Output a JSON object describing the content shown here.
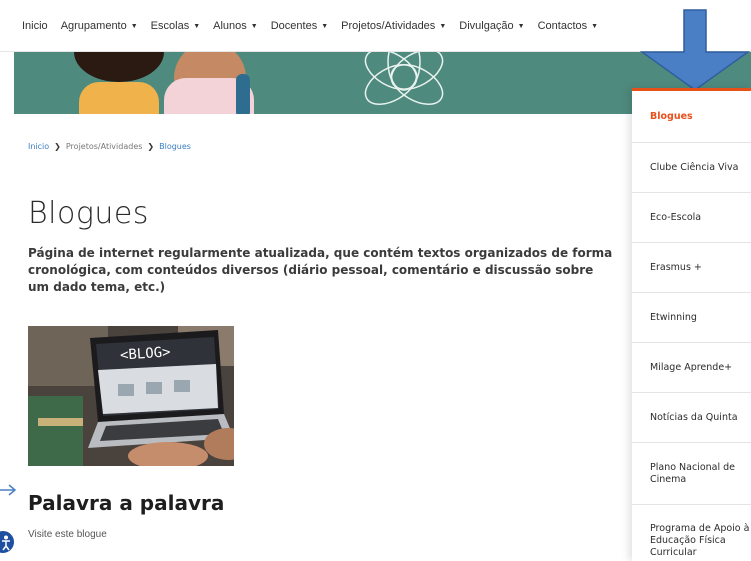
{
  "nav": {
    "items": [
      {
        "label": "Inicio",
        "dropdown": false
      },
      {
        "label": "Agrupamento",
        "dropdown": true
      },
      {
        "label": "Escolas",
        "dropdown": true
      },
      {
        "label": "Alunos",
        "dropdown": true
      },
      {
        "label": "Docentes",
        "dropdown": true
      },
      {
        "label": "Projetos/Atividades",
        "dropdown": true
      },
      {
        "label": "Divulgação",
        "dropdown": true
      },
      {
        "label": "Contactos",
        "dropdown": true
      }
    ]
  },
  "breadcrumb": {
    "items": [
      "Inicio",
      "Projetos/Atividades",
      "Blogues"
    ]
  },
  "page": {
    "title": "Blogues",
    "description": "Página de internet regularmente atualizada, que contém textos organizados de forma cronológica, com conteúdos diversos (diário pessoal, comentário e discussão sobre um dado tema, etc.)",
    "image_text": "<BLOG>"
  },
  "post": {
    "title": "Palavra a palavra",
    "link": "Visite este blogue"
  },
  "sidebar": {
    "items": [
      {
        "label": "Blogues",
        "active": true
      },
      {
        "label": "Clube Ciência Viva",
        "active": false
      },
      {
        "label": "Eco-Escola",
        "active": false
      },
      {
        "label": "Erasmus +",
        "active": false
      },
      {
        "label": "Etwinning",
        "active": false
      },
      {
        "label": "Milage Aprende+",
        "active": false
      },
      {
        "label": "Notícias da Quinta",
        "active": false
      },
      {
        "label": "Plano Nacional de Cinema",
        "active": false
      },
      {
        "label": "Programa de Apoio à Educação Física Curricular",
        "active": false
      }
    ]
  },
  "colors": {
    "accent": "#e8501a",
    "link": "#3a7fc1",
    "arrow": "#4a7fc6",
    "hero": "#4f8a7e"
  }
}
